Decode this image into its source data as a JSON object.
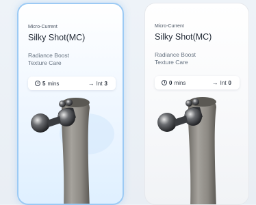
{
  "cards": [
    {
      "eyebrow": "Micro-Current",
      "title": "Silky Shot(MC)",
      "desc_line1": "Radiance Boost",
      "desc_line2": "Texture Care",
      "time_value": "5",
      "time_unit": "mins",
      "int_label": "Int",
      "int_value": "3",
      "selected": true,
      "time_icon": "clock-icon",
      "int_icon": "arrow-right-icon"
    },
    {
      "eyebrow": "Micro-Current",
      "title": "Silky Shot(MC)",
      "desc_line1": "Radiance Boost",
      "desc_line2": "Texture Care",
      "time_value": "0",
      "time_unit": "mins",
      "int_label": "Int",
      "int_value": "0",
      "selected": false,
      "time_icon": "clock-icon",
      "int_icon": "arrow-right-icon"
    }
  ],
  "colors": {
    "selected_border": "#9ccaf4",
    "device_body": "#8a8781",
    "head_metal": "#2b2d31"
  }
}
